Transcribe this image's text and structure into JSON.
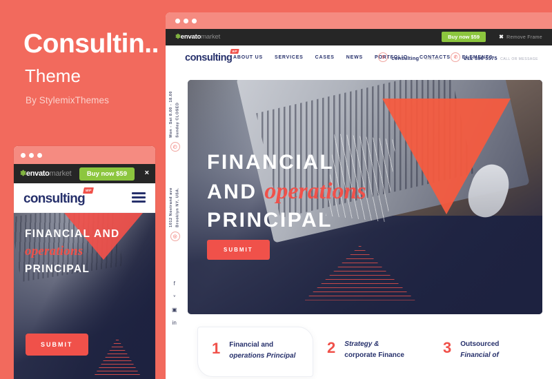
{
  "promo": {
    "title": "Consultin..",
    "subtitle": "Theme",
    "author": "By StylemixThemes"
  },
  "colors": {
    "brand_coral": "#f26a5d",
    "accent_red": "#f0514a",
    "navy": "#26306b",
    "envato_green": "#8cc63e",
    "envato_bar": "#262626"
  },
  "mobile_preview": {
    "envato_bar": {
      "logo_leaf": "✽",
      "logo_part1": "envato",
      "logo_part2": "market",
      "buy_label": "Buy now $59",
      "close_label": "×"
    },
    "nav": {
      "logo": "consulting",
      "logo_badge": "WP",
      "menu_icon": "hamburger-icon"
    },
    "hero": {
      "line1": "FINANCIAL AND",
      "line2_italic": "operations",
      "line3": "PRINCIPAL",
      "button": "SUBMIT"
    }
  },
  "browser": {
    "envato_bar": {
      "logo_leaf": "✽",
      "logo_part1": "envato",
      "logo_part2": "market",
      "buy_label": "Buy now $59",
      "remove_x": "✖",
      "remove_label": "Remove Frame"
    },
    "nav": {
      "logo": "consulting",
      "logo_badge": "WP",
      "menu": [
        {
          "label": "ABOUT US"
        },
        {
          "label": "SERVICES"
        },
        {
          "label": "CASES"
        },
        {
          "label": "NEWS"
        },
        {
          "label": "PORTFOLIO"
        },
        {
          "label": "CONTACTS"
        },
        {
          "label": "ELEMENTS"
        }
      ],
      "contacts": [
        {
          "icon": "skype-icon",
          "glyph": "S",
          "primary": "consulting",
          "secondary": "· ONLINE"
        },
        {
          "icon": "phone-icon",
          "glyph": "✆",
          "primary": "212 386 5575",
          "secondary": "CALL OR MESSAGE"
        }
      ]
    },
    "rail": {
      "hours": {
        "icon": "clock-icon",
        "glyph": "◴",
        "text": "Mon - Sat 8.00 - 18.00\nSunday CLOSED",
        "line1": "Mon - Sat 8.00 - 18.00",
        "line2": "Sunday CLOSED"
      },
      "address": {
        "icon": "location-pin-icon",
        "glyph": "◎",
        "line1": "1012 Nostrand ave",
        "line2": "Brooklyn NY, USA."
      },
      "social": [
        {
          "name": "facebook-icon",
          "glyph": "f"
        },
        {
          "name": "twitter-icon",
          "glyph": "ᵛ"
        },
        {
          "name": "instagram-icon",
          "glyph": "▣"
        },
        {
          "name": "linkedin-icon",
          "glyph": "in"
        }
      ]
    },
    "hero": {
      "line1": "FINANCIAL",
      "line2_prefix": "AND ",
      "line2_italic": "operations",
      "line3": "PRINCIPAL",
      "button": "SUBMIT"
    },
    "features": [
      {
        "number": "1",
        "line1": "Financial and",
        "line2": "operations Principal"
      },
      {
        "number": "2",
        "line1": "Strategy &",
        "line2": "corporate Finance"
      },
      {
        "number": "3",
        "line1": "Outsourced",
        "line2": "Financial of"
      }
    ]
  }
}
